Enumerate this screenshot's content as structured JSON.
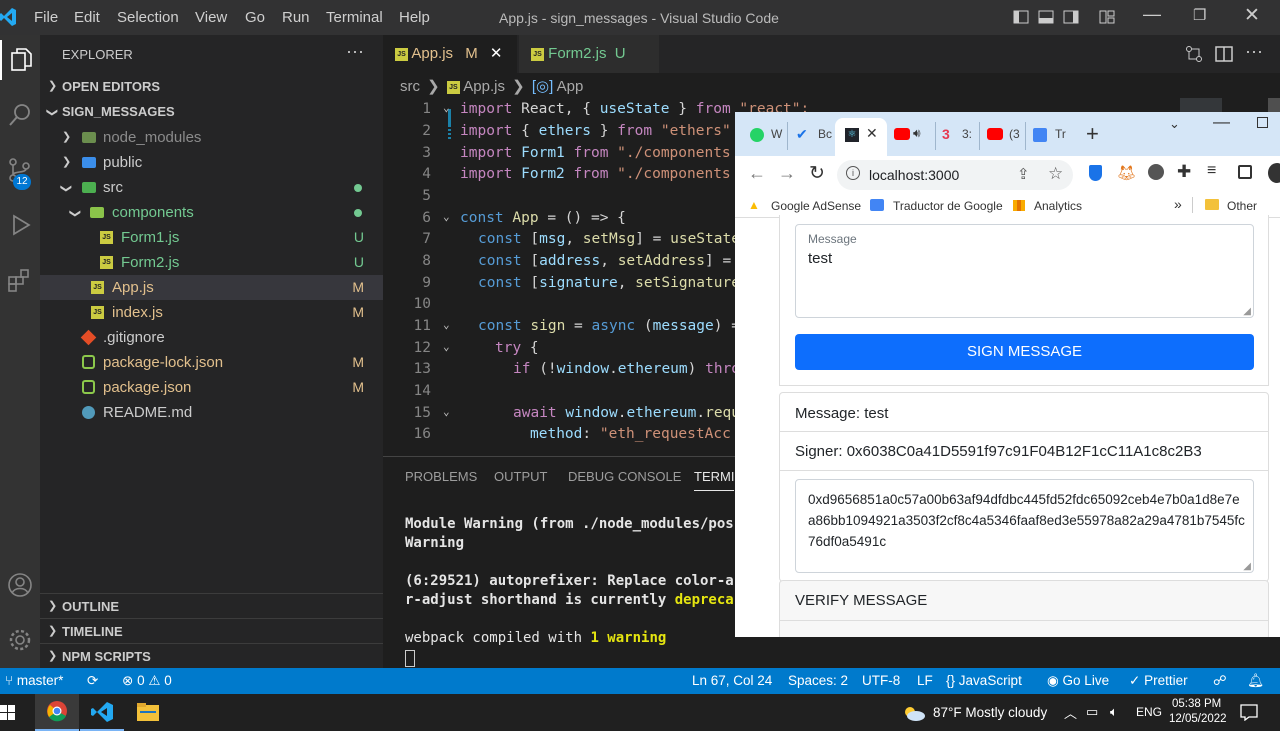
{
  "vscode": {
    "menu": [
      "File",
      "Edit",
      "Selection",
      "View",
      "Go",
      "Run",
      "Terminal",
      "Help"
    ],
    "window_title": "App.js - sign_messages - Visual Studio Code",
    "explorer": {
      "title": "EXPLORER",
      "open_editors": "OPEN EDITORS",
      "project": "SIGN_MESSAGES",
      "items": [
        {
          "label": "node_modules",
          "badge": ""
        },
        {
          "label": "public",
          "badge": ""
        },
        {
          "label": "src",
          "badge": ""
        },
        {
          "label": "components",
          "badge": ""
        },
        {
          "label": "Form1.js",
          "badge": "U"
        },
        {
          "label": "Form2.js",
          "badge": "U"
        },
        {
          "label": "App.js",
          "badge": "M"
        },
        {
          "label": "index.js",
          "badge": "M"
        },
        {
          "label": ".gitignore",
          "badge": ""
        },
        {
          "label": "package-lock.json",
          "badge": "M"
        },
        {
          "label": "package.json",
          "badge": "M"
        },
        {
          "label": "README.md",
          "badge": ""
        }
      ],
      "outline": "OUTLINE",
      "timeline": "TIMELINE",
      "npm_scripts": "NPM SCRIPTS"
    },
    "scm_badge": "12",
    "tabs": [
      {
        "label": "App.js",
        "badge": "M"
      },
      {
        "label": "Form2.js",
        "badge": "U"
      }
    ],
    "breadcrumb": {
      "folder": "src",
      "file": "App.js",
      "symbol": "App"
    },
    "line_numbers": [
      "1",
      "2",
      "3",
      "4",
      "5",
      "6",
      "7",
      "8",
      "9",
      "10",
      "11",
      "12",
      "13",
      "14",
      "15",
      "16"
    ],
    "code": {
      "l1": [
        "import",
        " React, { ",
        "useState",
        " } ",
        "from",
        " ",
        "\"react\";"
      ],
      "l2": [
        "import",
        " { ",
        "ethers",
        " } ",
        "from",
        " ",
        "\"ethers\""
      ],
      "l3": [
        "import",
        " ",
        "Form1",
        " ",
        "from",
        " ",
        "\"./components"
      ],
      "l4": [
        "import",
        " ",
        "Form2",
        " ",
        "from",
        " ",
        "\"./components"
      ],
      "l6": [
        "const",
        " ",
        "App",
        " = () => {"
      ],
      "l7": [
        "const",
        " [",
        "msg",
        ", ",
        "setMsg",
        "] = ",
        "useState"
      ],
      "l8": [
        "const",
        " [",
        "address",
        ", ",
        "setAddress",
        "] ="
      ],
      "l9": [
        "const",
        " [",
        "signature",
        ", ",
        "setSignature"
      ],
      "l11": [
        "const",
        " ",
        "sign",
        " = ",
        "async",
        " (",
        "message",
        ") ="
      ],
      "l12": [
        "try",
        " {"
      ],
      "l13": [
        "if",
        " (!",
        "window",
        ".",
        "ethereum",
        ") ",
        "thro"
      ],
      "l15": [
        "await",
        " ",
        "window",
        ".",
        "ethereum",
        ".",
        "requ"
      ],
      "l16": [
        "method",
        ": ",
        "\"eth_requestAcc"
      ]
    },
    "panel_tabs": [
      "PROBLEMS",
      "OUTPUT",
      "DEBUG CONSOLE",
      "TERMI"
    ],
    "terminal": {
      "line1": "Module Warning (from ./node_modules/pos",
      "line2": "Warning",
      "line3": "(6:29521) autoprefixer: Replace color-a",
      "line4a": "r-adjust shorthand is currently ",
      "line4b": "depreca",
      "line5a": "webpack compiled with ",
      "line5b": "1 warning"
    },
    "status": {
      "branch": "master*",
      "errors": "0",
      "warnings": "0",
      "position": "Ln 67, Col 24",
      "spaces": "Spaces: 2",
      "encoding": "UTF-8",
      "eol": "LF",
      "language": "JavaScript",
      "golive": "Go Live",
      "prettier": "Prettier"
    }
  },
  "chrome": {
    "tabs": [
      "W",
      "Bc",
      "",
      "",
      "3:",
      "(3",
      "Tr"
    ],
    "url": "localhost:3000",
    "bookmarks": [
      "Google AdSense",
      "Traductor de Google",
      "Analytics"
    ],
    "other_bookmarks": "Other boo",
    "form": {
      "message_label": "Message",
      "message_value": "test",
      "sign_button": "SIGN MESSAGE",
      "message_line": "Message: test",
      "signer_line": "Signer: 0x6038C0a41D5591f97c91F04B12F1cC11A1c8c2B3",
      "signature": "0xd9656851a0c57a00b63af94dfdbc445fd52fdc65092ceb4e7b0a1d8e7ea86bb1094921a3503f2cf8c4a5346faaf8ed3e55978a82a29a4781b7545fc76df0a5491c",
      "verify_title": "VERIFY MESSAGE"
    }
  },
  "taskbar": {
    "weather": "87°F  Mostly cloudy",
    "lang": "ENG",
    "time": "05:38 PM",
    "date": "12/05/2022"
  },
  "colors": {
    "vscode_blue": "#007acc",
    "button_blue": "#0d6efd",
    "chrome_tabbar": "#d5e6f7"
  }
}
